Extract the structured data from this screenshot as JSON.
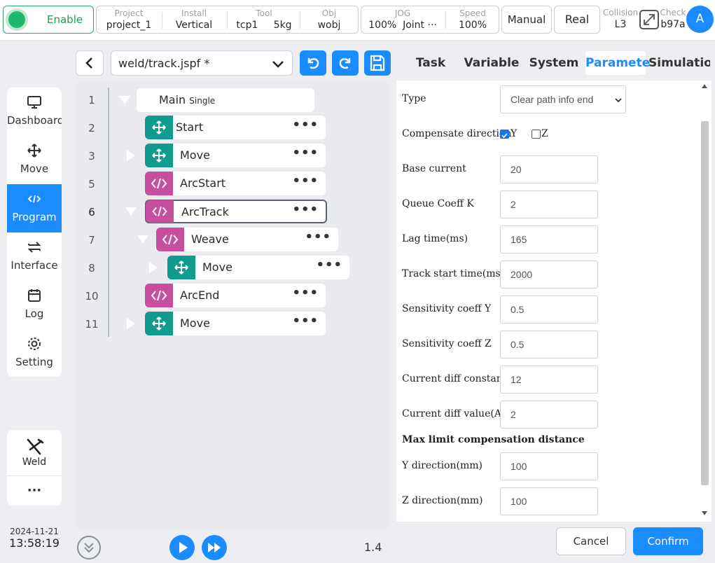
{
  "topbar": {
    "enable_label": "Enable",
    "project": {
      "label": "Project",
      "value": "project_1"
    },
    "install": {
      "label": "Install",
      "value": "Vertical"
    },
    "tool": {
      "label": "Tool",
      "value": "tcp1",
      "weight": "5kg"
    },
    "obj": {
      "label": "Obj",
      "value": "wobj"
    },
    "jog": {
      "label": "JOG",
      "value": "100%",
      "mode": "Joint ···"
    },
    "speed": {
      "label": "Speed",
      "value": "100%"
    },
    "manual_label": "Manual",
    "real_label": "Real",
    "collision": {
      "label": "Collision",
      "value": "L3"
    },
    "check": {
      "label": "Check",
      "value": "b97a"
    },
    "avatar": "A"
  },
  "sidebar": {
    "items": [
      {
        "label": "Dashboard",
        "icon": "monitor-icon"
      },
      {
        "label": "Move",
        "icon": "move-arrows-icon"
      },
      {
        "label": "Program",
        "icon": "code-icon",
        "active": true
      },
      {
        "label": "Interface",
        "icon": "swap-icon"
      },
      {
        "label": "Log",
        "icon": "calendar-icon"
      },
      {
        "label": "Setting",
        "icon": "gear-icon"
      }
    ],
    "weld_label": "Weld",
    "more_label": "···",
    "date": "2024-11-21",
    "time": "13:58:19"
  },
  "program": {
    "file": "weld/track.jspf *",
    "rows": [
      {
        "no": "1",
        "name": "Main",
        "sub": "Single"
      },
      {
        "no": "2",
        "name": "Start"
      },
      {
        "no": "3",
        "name": "Move"
      },
      {
        "no": "5",
        "name": "ArcStart"
      },
      {
        "no": "6",
        "name": "ArcTrack"
      },
      {
        "no": "7",
        "name": "Weave"
      },
      {
        "no": "8",
        "name": "Move"
      },
      {
        "no": "10",
        "name": "ArcEnd"
      },
      {
        "no": "11",
        "name": "Move"
      }
    ],
    "more": "•••",
    "version": "1.4"
  },
  "tabs": [
    "Task",
    "Variable",
    "System",
    "Paramete",
    "Simulatio"
  ],
  "form": {
    "type_label": "Type",
    "type_value": "Clear path info end",
    "comp_dir_label": "Compensate direction",
    "y_label": "Y",
    "z_label": "Z",
    "fields": [
      {
        "label": "Base current",
        "value": "20"
      },
      {
        "label": "Queue Coeff K",
        "value": "2"
      },
      {
        "label": "Lag time(ms)",
        "value": "165"
      },
      {
        "label": "Track start time(ms)",
        "value": "2000"
      },
      {
        "label": "Sensitivity coeff Y",
        "value": "0.5"
      },
      {
        "label": "Sensitivity coeff Z",
        "value": "0.5"
      },
      {
        "label": "Current diff constant",
        "value": "12"
      },
      {
        "label": "Current diff value(A)",
        "value": "2"
      }
    ],
    "section_label": "Max limit compensation distance",
    "ydir": {
      "label": "Y direction(mm)",
      "value": "100"
    },
    "zdir": {
      "label": "Z direction(mm)",
      "value": "100"
    }
  },
  "buttons": {
    "cancel": "Cancel",
    "confirm": "Confirm"
  },
  "colors": {
    "accent": "#1a8cff",
    "teal": "#0f9b8e",
    "magenta": "#c84e9f",
    "enable": "#1fb86a"
  }
}
